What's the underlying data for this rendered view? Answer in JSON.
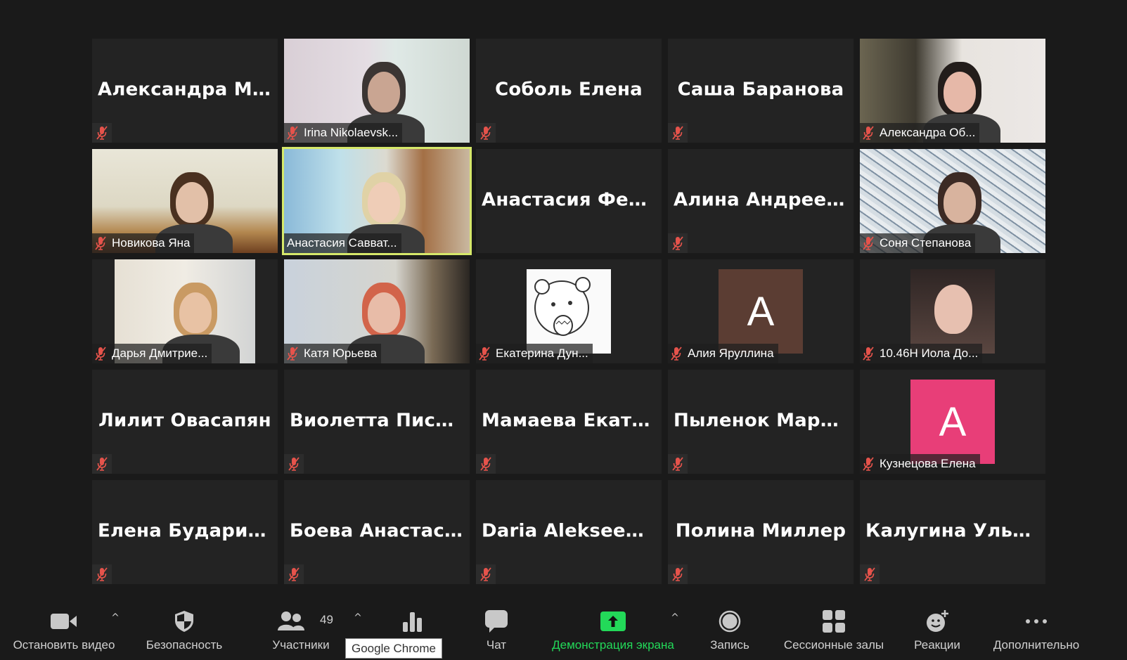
{
  "colors": {
    "muted_mic": "#e5534b",
    "active_speaker_border": "#d6e86a",
    "share_green": "#23d959",
    "tile_bg": "#232323"
  },
  "tiles": [
    {
      "name": "Александра  М...",
      "type": "name"
    },
    {
      "name": "Irina Nikolaevsk...",
      "type": "video"
    },
    {
      "name": "Соболь Елена",
      "type": "name"
    },
    {
      "name": "Саша Баранова",
      "type": "name"
    },
    {
      "name": "Александра Об...",
      "type": "video"
    },
    {
      "name": "Новикова Яна",
      "type": "video"
    },
    {
      "name": "Анастасия Савват...",
      "type": "video",
      "active": true,
      "muted": false
    },
    {
      "name": "Анастасия  Фед...",
      "type": "name",
      "muted": false
    },
    {
      "name": "Алина Андреева",
      "type": "name"
    },
    {
      "name": "Соня Степанова",
      "type": "video"
    },
    {
      "name": "Дарья Дмитрие...",
      "type": "video"
    },
    {
      "name": "Катя Юрьева",
      "type": "video"
    },
    {
      "name": "Екатерина Дун...",
      "type": "avatar-image"
    },
    {
      "name": "Алия Яруллина",
      "type": "avatar",
      "letter": "A",
      "color": "#5b3d33"
    },
    {
      "name": "10.46Н Иола До...",
      "type": "avatar-image"
    },
    {
      "name": "Лилит Овасапян",
      "type": "name"
    },
    {
      "name": "Виолетта  Писа...",
      "type": "name"
    },
    {
      "name": "Мамаева  Екате...",
      "type": "name"
    },
    {
      "name": "Пыленок  Марг...",
      "type": "name"
    },
    {
      "name": "Кузнецова Елена",
      "type": "avatar",
      "letter": "A",
      "color": "#e83e78"
    },
    {
      "name": "Елена Бударина",
      "type": "name"
    },
    {
      "name": "Боева Анастасия",
      "type": "name"
    },
    {
      "name": "Daria Alekseenko",
      "type": "name"
    },
    {
      "name": "Полина  Миллер",
      "type": "name"
    },
    {
      "name": "Калугина Ульяна",
      "type": "name"
    }
  ],
  "toolbar": {
    "stop_video": {
      "label": "Остановить видео",
      "icon": "video-camera-icon"
    },
    "security": {
      "label": "Безопасность",
      "icon": "shield-icon"
    },
    "participants": {
      "label": "Участники",
      "icon": "participants-icon",
      "count": "49"
    },
    "polls": {
      "icon": "bar-chart-icon"
    },
    "chat": {
      "label": "Чат",
      "icon": "chat-bubble-icon"
    },
    "share_screen": {
      "label": "Демонстрация экрана",
      "icon": "share-screen-arrow-icon"
    },
    "record": {
      "label": "Запись",
      "icon": "record-icon"
    },
    "breakout_rooms": {
      "label": "Сессионные залы",
      "icon": "grid-icon"
    },
    "reactions": {
      "label": "Реакции",
      "icon": "smiley-plus-icon"
    },
    "more": {
      "label": "Дополнительно",
      "icon": "ellipsis-icon"
    },
    "tooltip": "Google Chrome"
  }
}
